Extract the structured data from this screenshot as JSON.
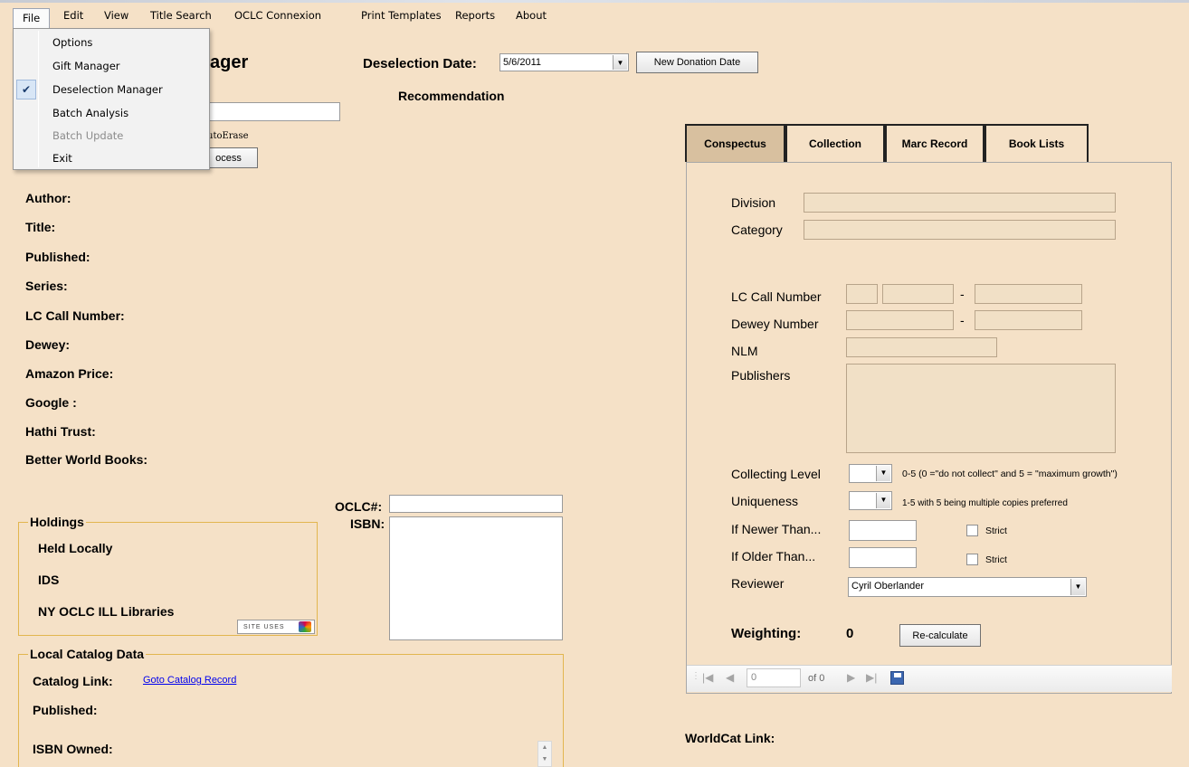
{
  "menubar": {
    "items": [
      "File",
      "Edit",
      "View",
      "Title Search",
      "OCLC Connexion",
      "Print Templates",
      "Reports",
      "About"
    ]
  },
  "file_menu": {
    "items": [
      "Options",
      "Gift Manager",
      "Deselection Manager",
      "Batch Analysis",
      "Batch Update",
      "Exit"
    ],
    "checked": "Deselection Manager",
    "disabled": "Batch Update"
  },
  "header": {
    "title_partial": "ager",
    "autoerase_partial": "utoErase",
    "process_partial": "ocess",
    "deselection_label": "Deselection Date:",
    "deselection_value": "5/6/2011",
    "new_donation_button": "New Donation Date",
    "recommendation": "Recommendation"
  },
  "record": {
    "labels": [
      "Author:",
      "Title:",
      "Published:",
      "Series:",
      "LC Call Number:",
      "Dewey:",
      "Amazon Price:",
      "Google :",
      "Hathi Trust:",
      "Better World Books:"
    ],
    "oclc_label": "OCLC#:",
    "isbn_label": "ISBN:"
  },
  "holdings": {
    "title": "Holdings",
    "items": [
      "Held Locally",
      "IDS",
      "NY OCLC ILL Libraries"
    ],
    "site_uses": "SITE USES"
  },
  "local_catalog": {
    "title": "Local Catalog Data",
    "catalog_link_label": "Catalog Link:",
    "catalog_link_text": "Goto Catalog Record",
    "published_label": "Published:",
    "isbn_owned_label": "ISBN Owned:"
  },
  "tabs": [
    "Conspectus",
    "Collection",
    "Marc Record",
    "Book Lists"
  ],
  "conspectus": {
    "division": "Division",
    "category": "Category",
    "lc_call_number": "LC Call Number",
    "dewey_number": "Dewey Number",
    "nlm": "NLM",
    "publishers": "Publishers",
    "collecting_level": "Collecting Level",
    "collecting_hint": "0-5  (0 =\"do not collect\" and 5 = \"maximum growth\")",
    "uniqueness": "Uniqueness",
    "uniqueness_hint": "1-5 with 5 being multiple copies preferred",
    "newer_than": "If Newer Than...",
    "older_than": "If Older Than...",
    "strict": "Strict",
    "reviewer": "Reviewer",
    "reviewer_value": "Cyril Oberlander",
    "weighting_label": "Weighting:",
    "weighting_value": "0",
    "recalc_button": "Re-calculate",
    "dash": "-"
  },
  "navigator": {
    "position": "0",
    "of": "of 0"
  },
  "worldcat": {
    "label": "WorldCat Link:"
  }
}
